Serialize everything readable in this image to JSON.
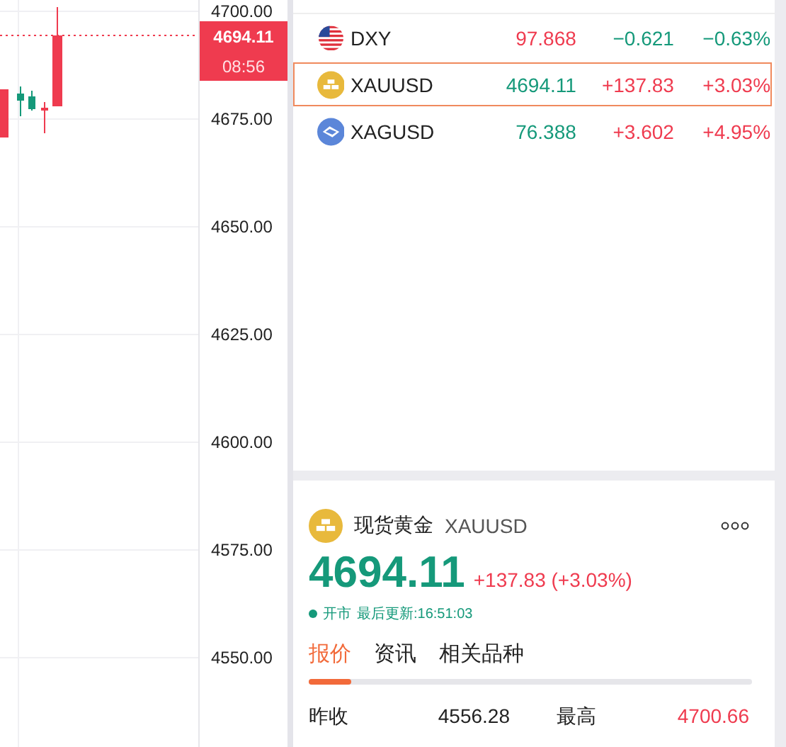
{
  "chart": {
    "price_ticks": [
      "4700.00",
      "4675.00",
      "4650.00",
      "4625.00",
      "4600.00",
      "4575.00",
      "4550.00"
    ],
    "price_tag": {
      "price": "4694.11",
      "countdown": "08:56"
    }
  },
  "watchlist": [
    {
      "kind": "flag",
      "symbol": "DXY",
      "price": "97.868",
      "price_up": true,
      "change": "−0.621",
      "change_pct": "−0.63%",
      "change_up": false,
      "selected": false
    },
    {
      "kind": "ingot",
      "symbol": "XAUUSD",
      "price": "4694.11",
      "price_up": false,
      "change": "+137.83",
      "change_pct": "+3.03%",
      "change_up": true,
      "selected": true
    },
    {
      "kind": "diamond",
      "symbol": "XAGUSD",
      "price": "76.388",
      "price_up": false,
      "change": "+3.602",
      "change_pct": "+4.95%",
      "change_up": true,
      "selected": false
    }
  ],
  "detail": {
    "kind": "ingot",
    "name": "现货黄金",
    "symbol": "XAUUSD",
    "price": "4694.11",
    "price_up": false,
    "change": "+137.83 (+3.03%)",
    "change_up": true,
    "status": "开市",
    "updated": "最后更新:16:51:03",
    "tabs": [
      {
        "label": "报价",
        "selected": true
      },
      {
        "label": "资讯",
        "selected": false
      },
      {
        "label": "相关品种",
        "selected": false
      }
    ],
    "stats": [
      {
        "label": "昨收",
        "value": "4556.28",
        "highlighted": false
      },
      {
        "label": "最高",
        "value": "4700.66",
        "highlighted": true
      }
    ]
  }
}
